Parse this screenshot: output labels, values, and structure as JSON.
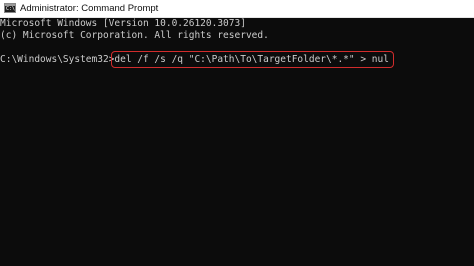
{
  "window": {
    "title": "Administrator: Command Prompt",
    "icon_name": "command-prompt-icon",
    "icon_glyph": "C:\\"
  },
  "console": {
    "banner_line1": "Microsoft Windows [Version 10.0.26120.3073]",
    "banner_line2": "(c) Microsoft Corporation. All rights reserved.",
    "prompt": "C:\\Windows\\System32>",
    "command": "del /f /s /q \"C:\\Path\\To\\TargetFolder\\*.*\" > nul"
  },
  "colors": {
    "background": "#0c0c0c",
    "text": "#cccccc",
    "highlight_border": "#d12c2c",
    "titlebar": "#ffffff"
  }
}
